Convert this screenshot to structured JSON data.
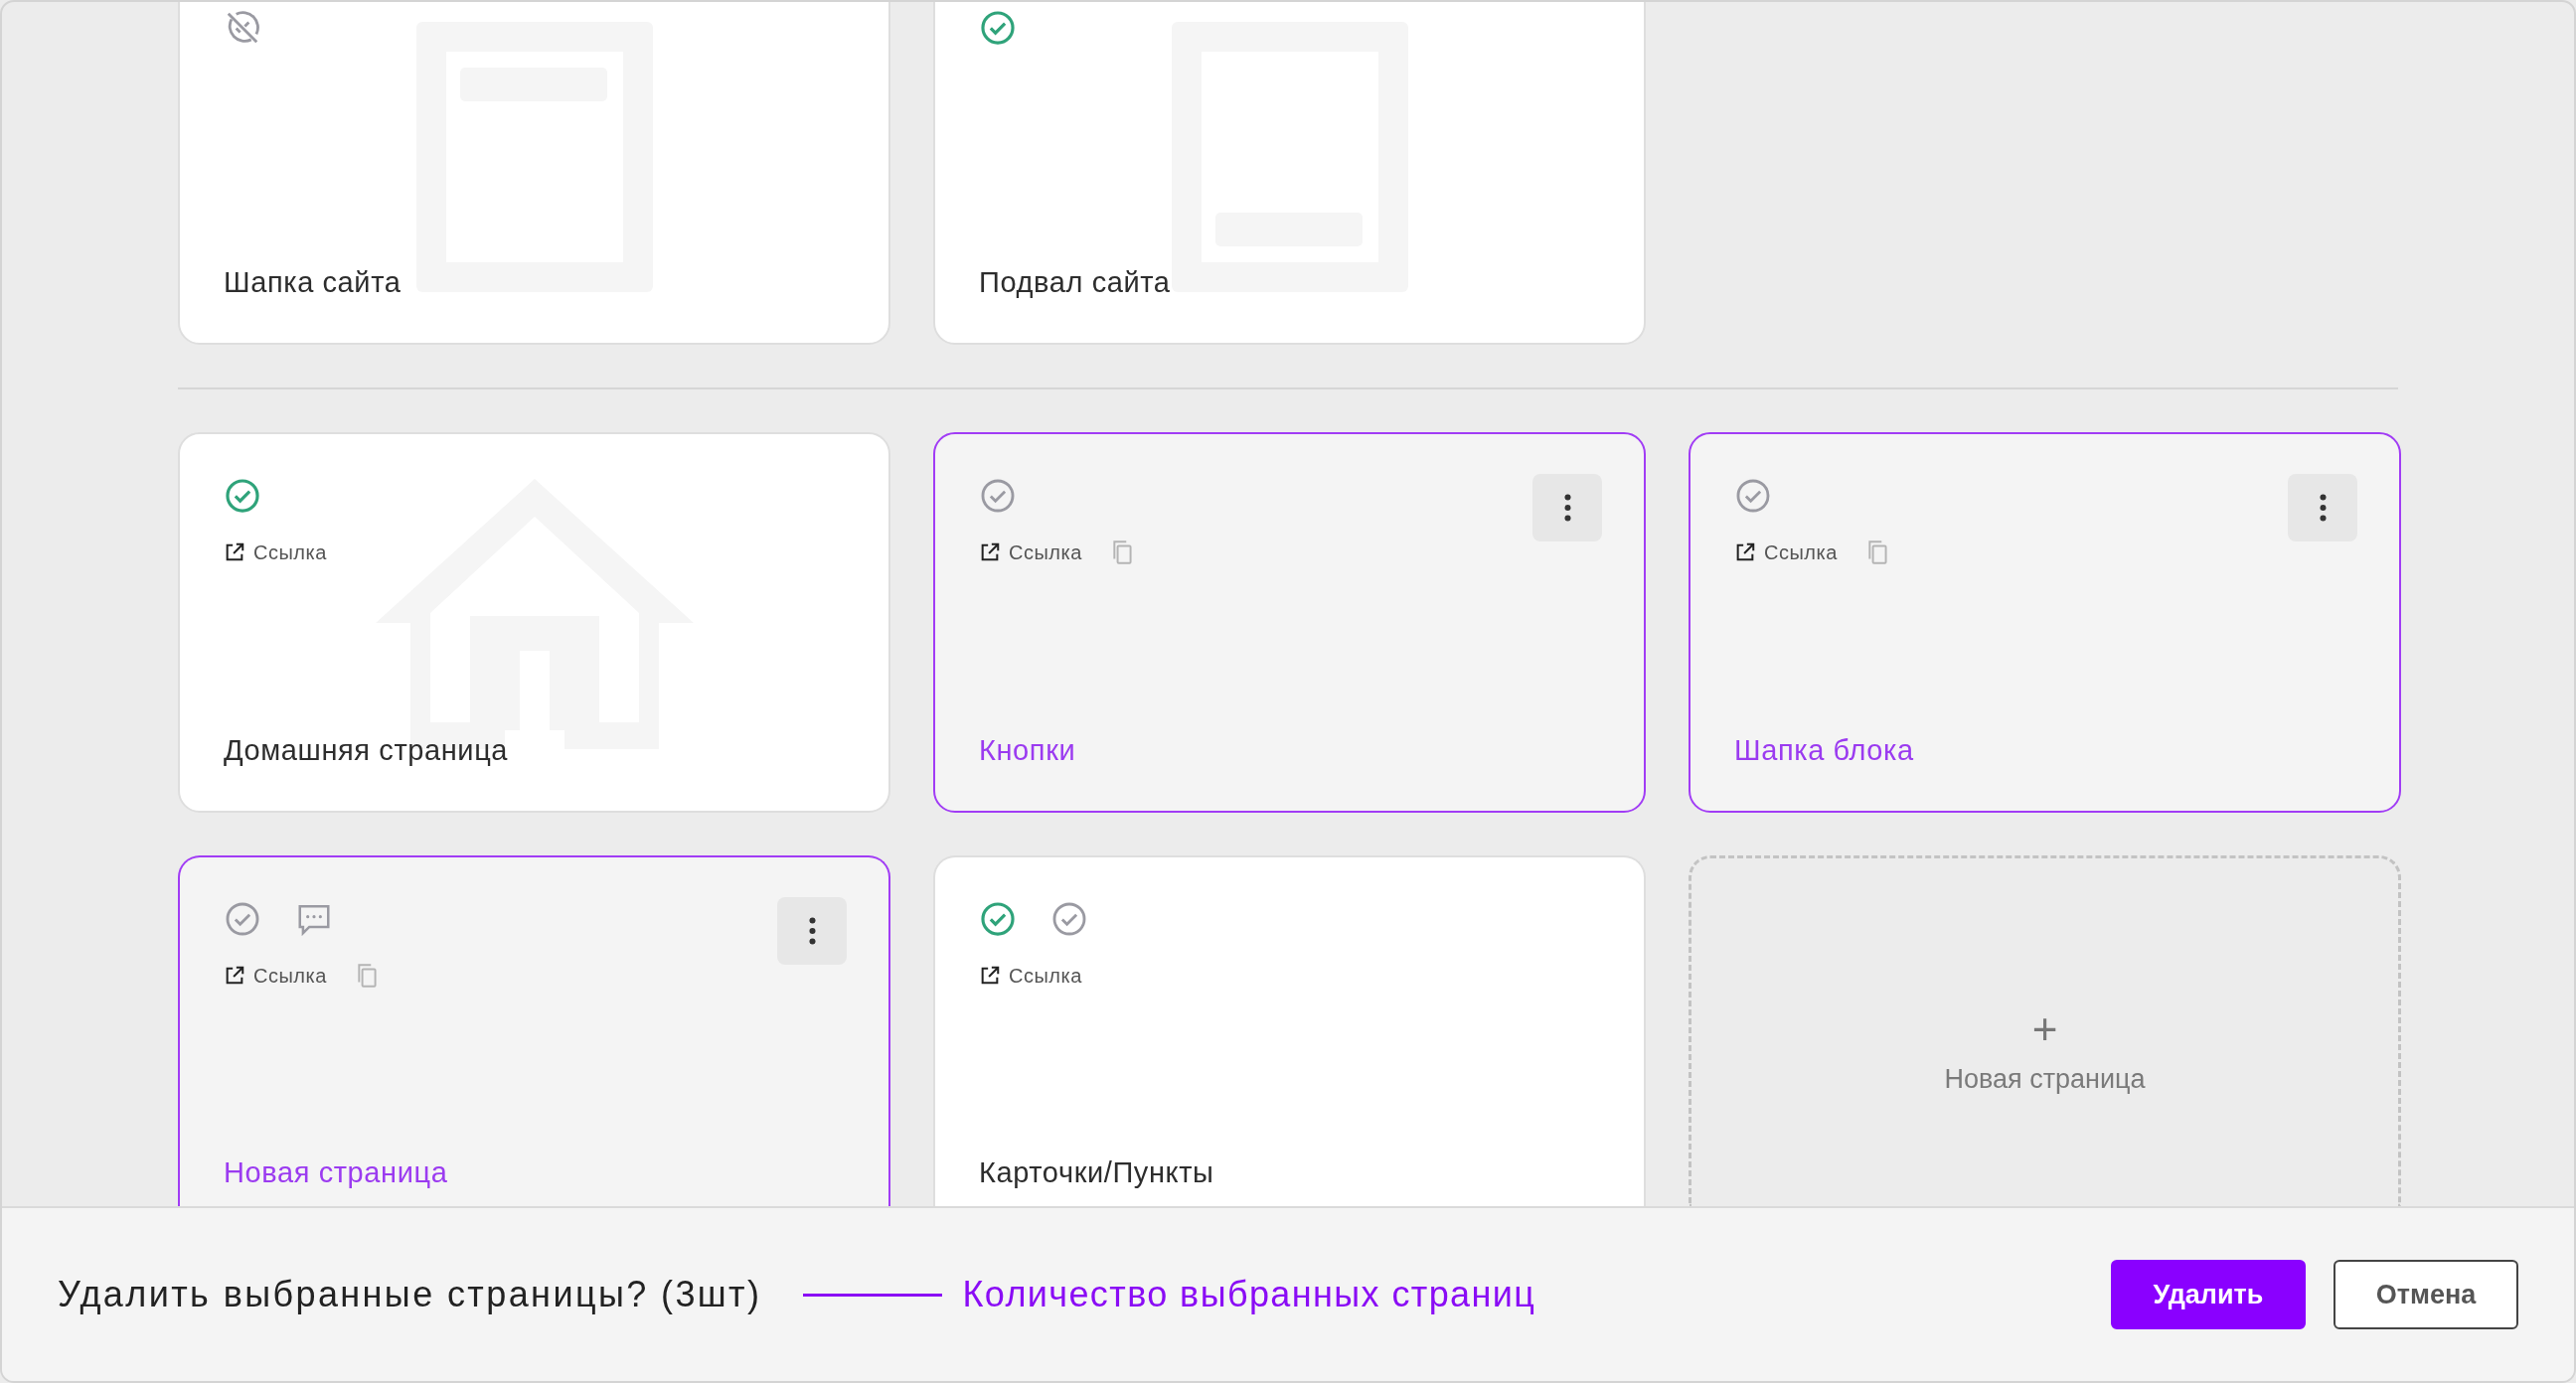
{
  "sections": [
    {
      "cards": [
        {
          "title": "Шапка сайта",
          "selected": false,
          "kind": "header",
          "statuses": [
            {
              "kind": "hidden"
            }
          ],
          "copy": false,
          "menu": false
        },
        {
          "title": "Подвал сайта",
          "selected": false,
          "kind": "footer",
          "statuses": [
            {
              "kind": "published"
            }
          ],
          "copy": false,
          "menu": false
        }
      ]
    },
    {
      "cards": [
        {
          "title": "Домашняя страница",
          "selected": false,
          "kind": "home",
          "statuses": [
            {
              "kind": "published"
            }
          ],
          "link": "Ссылка",
          "copy": false,
          "menu": false
        },
        {
          "title": "Кнопки",
          "selected": true,
          "kind": "page",
          "statuses": [
            {
              "kind": "draft"
            }
          ],
          "link": "Ссылка",
          "copy": true,
          "menu": true
        },
        {
          "title": "Шапка блока",
          "selected": true,
          "kind": "page",
          "statuses": [
            {
              "kind": "draft"
            }
          ],
          "link": "Ссылка",
          "copy": true,
          "menu": true
        },
        {
          "title": "Новая страница",
          "selected": true,
          "kind": "page",
          "statuses": [
            {
              "kind": "draft"
            },
            {
              "kind": "comment"
            }
          ],
          "link": "Ссылка",
          "copy": true,
          "menu": true
        },
        {
          "title": "Карточки/Пункты",
          "selected": false,
          "kind": "page",
          "statuses": [
            {
              "kind": "published"
            },
            {
              "kind": "draft"
            }
          ],
          "link": "Ссылка",
          "copy": false,
          "menu": false
        }
      ],
      "add_card": {
        "icon": "+",
        "label": "Новая страница"
      }
    }
  ],
  "delete_bar": {
    "question": "Удалить выбранные страницы? (3шт)",
    "annotation": "Количество выбранных страниц",
    "buttons": [
      {
        "label": "Удалить",
        "kind": "primary"
      },
      {
        "label": "Отмена",
        "kind": "secondary"
      }
    ]
  }
}
